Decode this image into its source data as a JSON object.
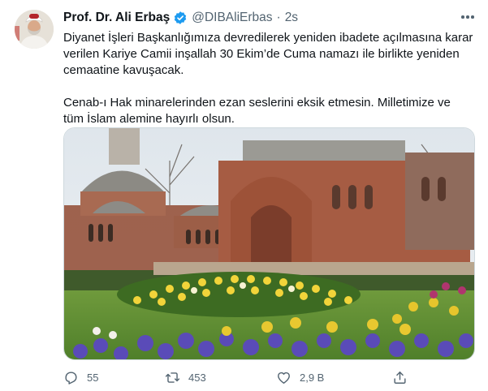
{
  "tweet": {
    "author_name": "Prof. Dr. Ali Erbaş",
    "handle": "@DIBAliErbas",
    "separator": "·",
    "time": "2s",
    "paragraphs": [
      "Diyanet İşleri Başkanlığımıza devredilerek yeniden ibadete açılmasına karar\nverilen Kariye Camii inşallah 30 Ekim’de Cuma namazı ile birlikte yeniden\ncemaatine kavuşacak.",
      "Cenab-ı Hak minarelerinden ezan seslerini eksik etmesin. Milletimize ve\ntüm İslam alemine hayırlı olsun."
    ],
    "verified": true,
    "accent_color": "#1d9bf0"
  },
  "actions": {
    "reply_count": "55",
    "retweet_count": "453",
    "like_count": "2,9 B"
  },
  "icons": {
    "verified": "verified-badge-icon",
    "more": "more-horizontal-icon",
    "reply": "reply-icon",
    "retweet": "retweet-icon",
    "like": "heart-icon",
    "share": "share-icon"
  }
}
